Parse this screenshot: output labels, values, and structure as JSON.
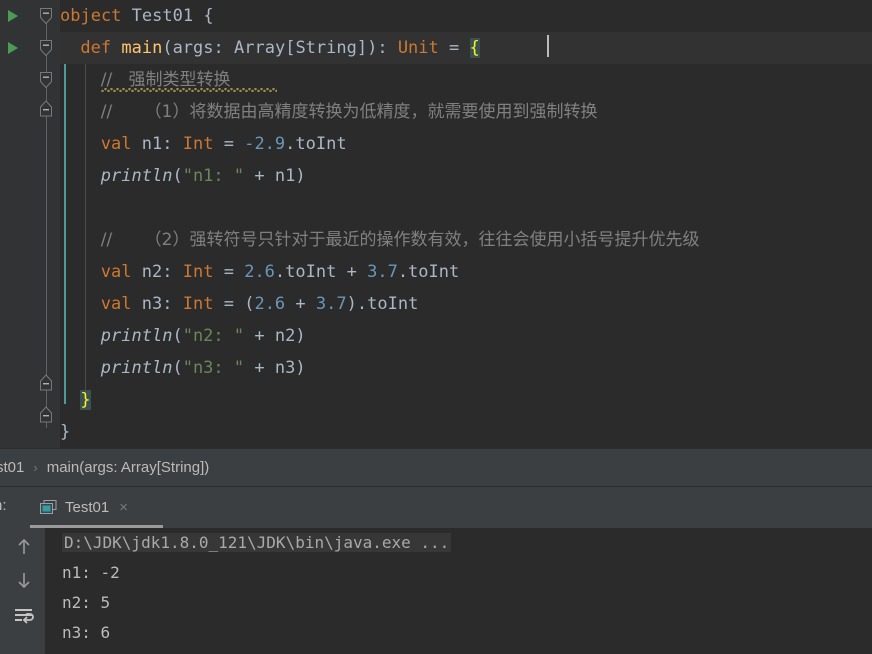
{
  "editor": {
    "background": "#2b2b2b",
    "gutter_background": "#313335",
    "language": "scala",
    "lines": [
      {
        "n": 1,
        "indent": 0,
        "tokens": [
          {
            "t": "object",
            "c": "kw"
          },
          {
            "t": " ",
            "c": "punct"
          },
          {
            "t": "Test01",
            "c": "ident"
          },
          {
            "t": " ",
            "c": "punct"
          },
          {
            "t": "{",
            "c": "punct"
          }
        ]
      },
      {
        "n": 2,
        "indent": 1,
        "tokens": [
          {
            "t": "def",
            "c": "kw"
          },
          {
            "t": " ",
            "c": "punct"
          },
          {
            "t": "main",
            "c": "fnname"
          },
          {
            "t": "(",
            "c": "punct"
          },
          {
            "t": "args",
            "c": "ident"
          },
          {
            "t": ": ",
            "c": "punct"
          },
          {
            "t": "Array",
            "c": "ident"
          },
          {
            "t": "[",
            "c": "punct"
          },
          {
            "t": "String",
            "c": "ident"
          },
          {
            "t": "]): ",
            "c": "punct"
          },
          {
            "t": "Unit",
            "c": "kw"
          },
          {
            "t": " ",
            "c": "punct"
          },
          {
            "t": "=",
            "c": "op"
          },
          {
            "t": " ",
            "c": "punct"
          },
          {
            "t": "{",
            "c": "brace-hl"
          }
        ]
      },
      {
        "n": 3,
        "indent": 2,
        "tokens": [
          {
            "t": "//   强制类型转换",
            "c": "cmt"
          }
        ]
      },
      {
        "n": 4,
        "indent": 2,
        "tokens": [
          {
            "t": "//      （1）将数据由高精度转换为低精度，就需要使用到强制转换",
            "c": "cmt"
          }
        ]
      },
      {
        "n": 5,
        "indent": 2,
        "tokens": [
          {
            "t": "val",
            "c": "kw"
          },
          {
            "t": " ",
            "c": "punct"
          },
          {
            "t": "n1",
            "c": "ident"
          },
          {
            "t": ": ",
            "c": "punct"
          },
          {
            "t": "Int",
            "c": "kw"
          },
          {
            "t": " ",
            "c": "punct"
          },
          {
            "t": "=",
            "c": "op"
          },
          {
            "t": " ",
            "c": "punct"
          },
          {
            "t": "-2.9",
            "c": "num"
          },
          {
            "t": ".toInt",
            "c": "ident"
          }
        ]
      },
      {
        "n": 6,
        "indent": 2,
        "tokens": [
          {
            "t": "println",
            "c": "italfn"
          },
          {
            "t": "(",
            "c": "punct"
          },
          {
            "t": "\"n1: \"",
            "c": "str"
          },
          {
            "t": " ",
            "c": "punct"
          },
          {
            "t": "+",
            "c": "op"
          },
          {
            "t": " ",
            "c": "punct"
          },
          {
            "t": "n1",
            "c": "ident"
          },
          {
            "t": ")",
            "c": "punct"
          }
        ]
      },
      {
        "n": 7,
        "indent": 2,
        "tokens": []
      },
      {
        "n": 8,
        "indent": 2,
        "tokens": [
          {
            "t": "//      （2）强转符号只针对于最近的操作数有效，往往会使用小括号提升优先级",
            "c": "cmt"
          }
        ]
      },
      {
        "n": 9,
        "indent": 2,
        "tokens": [
          {
            "t": "val",
            "c": "kw"
          },
          {
            "t": " ",
            "c": "punct"
          },
          {
            "t": "n2",
            "c": "ident"
          },
          {
            "t": ": ",
            "c": "punct"
          },
          {
            "t": "Int",
            "c": "kw"
          },
          {
            "t": " ",
            "c": "punct"
          },
          {
            "t": "=",
            "c": "op"
          },
          {
            "t": " ",
            "c": "punct"
          },
          {
            "t": "2.6",
            "c": "num"
          },
          {
            "t": ".toInt",
            "c": "ident"
          },
          {
            "t": " ",
            "c": "punct"
          },
          {
            "t": "+",
            "c": "op"
          },
          {
            "t": " ",
            "c": "punct"
          },
          {
            "t": "3.7",
            "c": "num"
          },
          {
            "t": ".toInt",
            "c": "ident"
          }
        ]
      },
      {
        "n": 10,
        "indent": 2,
        "tokens": [
          {
            "t": "val",
            "c": "kw"
          },
          {
            "t": " ",
            "c": "punct"
          },
          {
            "t": "n3",
            "c": "ident"
          },
          {
            "t": ": ",
            "c": "punct"
          },
          {
            "t": "Int",
            "c": "kw"
          },
          {
            "t": " ",
            "c": "punct"
          },
          {
            "t": "=",
            "c": "op"
          },
          {
            "t": " ",
            "c": "punct"
          },
          {
            "t": "(",
            "c": "punct"
          },
          {
            "t": "2.6",
            "c": "num"
          },
          {
            "t": " ",
            "c": "punct"
          },
          {
            "t": "+",
            "c": "op"
          },
          {
            "t": " ",
            "c": "punct"
          },
          {
            "t": "3.7",
            "c": "num"
          },
          {
            "t": ")",
            "c": "punct"
          },
          {
            "t": ".toInt",
            "c": "ident"
          }
        ]
      },
      {
        "n": 11,
        "indent": 2,
        "tokens": [
          {
            "t": "println",
            "c": "italfn"
          },
          {
            "t": "(",
            "c": "punct"
          },
          {
            "t": "\"n2: \"",
            "c": "str"
          },
          {
            "t": " ",
            "c": "punct"
          },
          {
            "t": "+",
            "c": "op"
          },
          {
            "t": " ",
            "c": "punct"
          },
          {
            "t": "n2",
            "c": "ident"
          },
          {
            "t": ")",
            "c": "punct"
          }
        ]
      },
      {
        "n": 12,
        "indent": 2,
        "tokens": [
          {
            "t": "println",
            "c": "italfn"
          },
          {
            "t": "(",
            "c": "punct"
          },
          {
            "t": "\"n3: \"",
            "c": "str"
          },
          {
            "t": " ",
            "c": "punct"
          },
          {
            "t": "+",
            "c": "op"
          },
          {
            "t": " ",
            "c": "punct"
          },
          {
            "t": "n3",
            "c": "ident"
          },
          {
            "t": ")",
            "c": "punct"
          }
        ]
      },
      {
        "n": 13,
        "indent": 1,
        "tokens": [
          {
            "t": "}",
            "c": "brace-hl"
          }
        ]
      },
      {
        "n": 14,
        "indent": 0,
        "tokens": [
          {
            "t": "}",
            "c": "punct"
          }
        ]
      }
    ],
    "run_gutter_lines": [
      1,
      2
    ],
    "caret_line": 2
  },
  "breadcrumb": {
    "items": [
      "st01",
      "main(args: Array[String])"
    ],
    "separator": "›"
  },
  "run_window": {
    "label": "n:",
    "tab_title": "Test01",
    "close_glyph": "×",
    "toolbar_icons": [
      "arrow-up-icon",
      "arrow-down-icon",
      "soft-wrap-icon"
    ],
    "console_lines": [
      {
        "text": "D:\\JDK\\jdk1.8.0_121\\JDK\\bin\\java.exe ...",
        "style": "command"
      },
      {
        "text": "n1: -2",
        "style": "normal"
      },
      {
        "text": "n2: 5",
        "style": "normal"
      },
      {
        "text": "n3: 6",
        "style": "normal"
      }
    ]
  },
  "colors": {
    "editor_bg": "#2b2b2b",
    "panel_bg": "#3c3f41",
    "keyword": "#cc7832",
    "identifier": "#a9b7c6",
    "function": "#ffc66d",
    "number": "#6897bb",
    "string": "#6a8759",
    "comment": "#808080",
    "run_green": "#499c54",
    "brace_match_bg": "#3b514d",
    "brace_match_fg": "#ffef28",
    "method_bar": "#4e9a9a"
  }
}
